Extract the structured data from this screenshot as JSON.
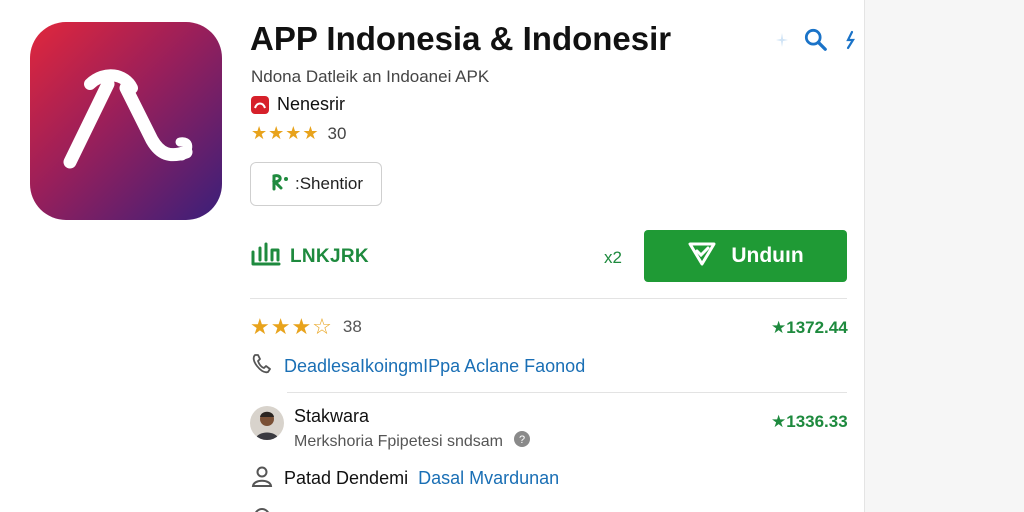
{
  "app": {
    "title": "APP Indonesia & Indonesir",
    "subtitle": "Ndona Datleik an Indoanei APK",
    "developer": "Nenesrir",
    "rating_stars": "★★★★",
    "rating_count": "30",
    "icon": "app-logo-lambda"
  },
  "header_icons": [
    "sparkle-icon",
    "search-icon",
    "pin-icon"
  ],
  "share_button": {
    "label": ":Shentior",
    "icon": "share-p-icon"
  },
  "link_row": {
    "label": "LNKJRK",
    "icon": "bar-chart-icon"
  },
  "count_label": "x2",
  "download_button": {
    "label": "Unduın",
    "icon": "download-check-icon"
  },
  "details": {
    "review_stars": "★★★☆",
    "review_count": "38",
    "review_value": "★1372.44",
    "phone_text": "DeadlesaIkoingmIPpa Aclane Faonod",
    "author_name": "Stakwara",
    "author_desc": "Merkshoria Fpipetesi sndsam",
    "author_value": "★1336.33",
    "person_text_a": "Patad Dendemi",
    "person_text_b": "Dasal Mvardunan"
  },
  "colors": {
    "accent_green": "#1f9a35",
    "text_green": "#1e8a3e",
    "link_blue": "#1a6fb5",
    "star_gold": "#e8a31c",
    "icon_gradient_start": "#e1273c",
    "icon_gradient_end": "#3a1f7a"
  }
}
